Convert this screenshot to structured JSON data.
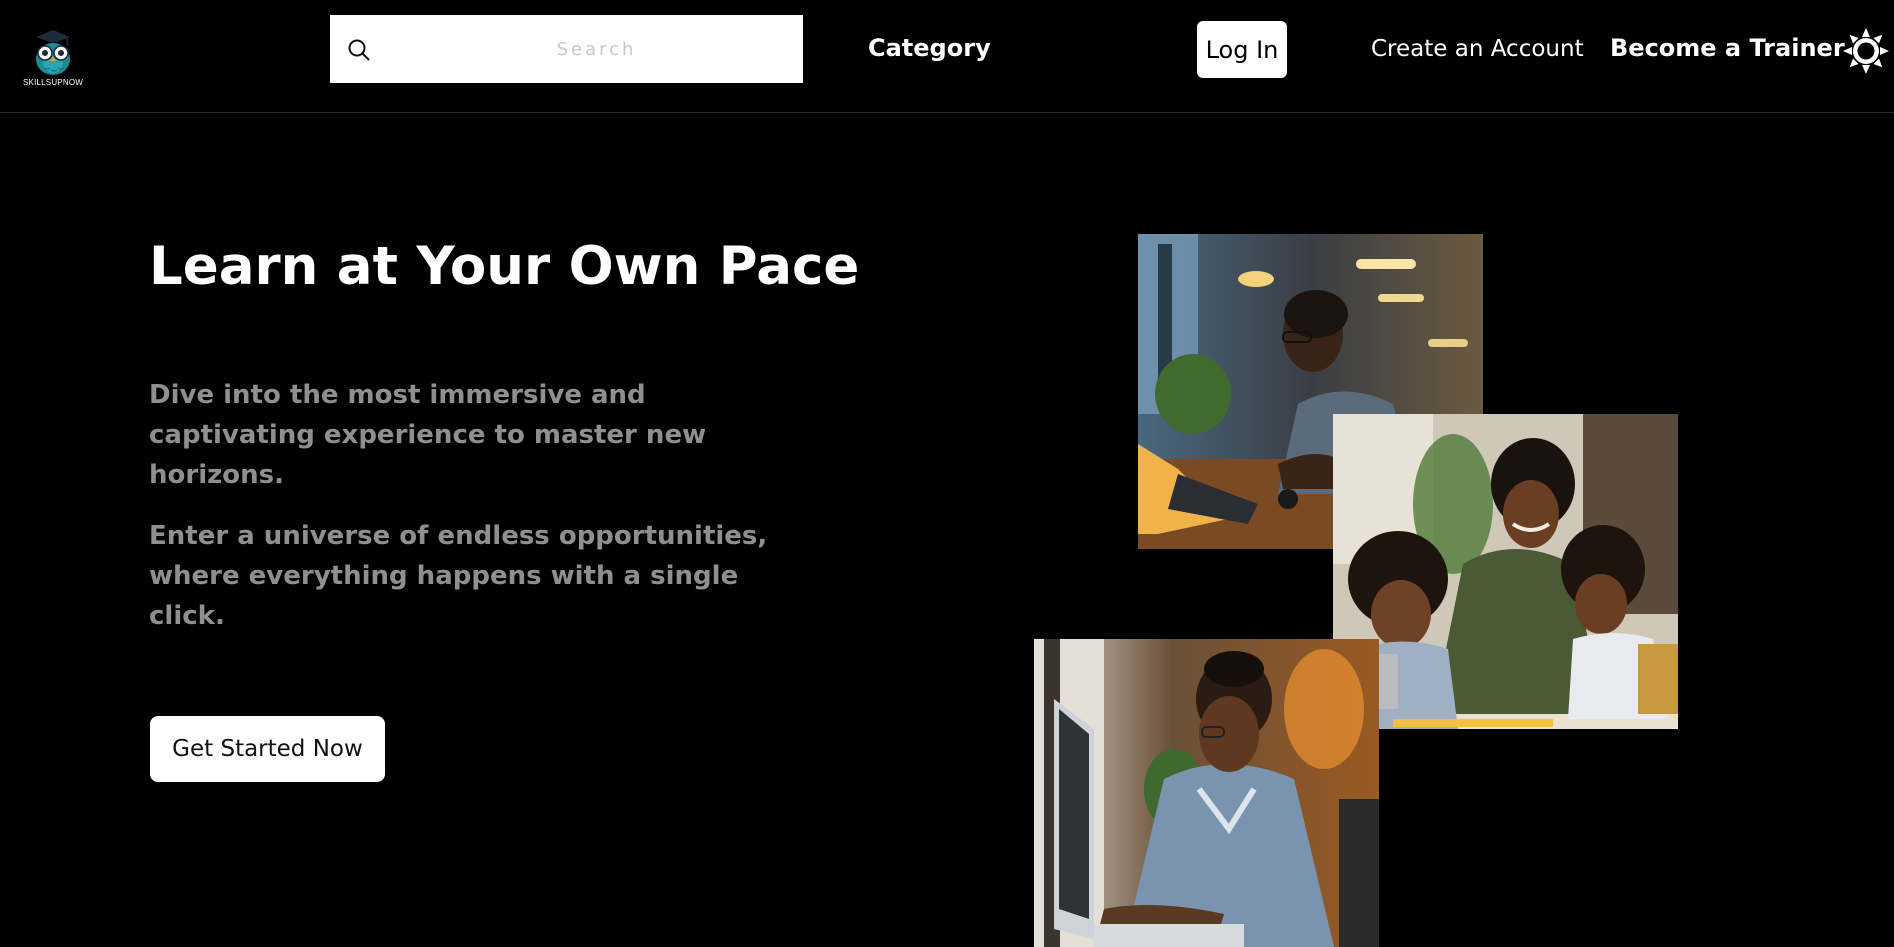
{
  "brand": {
    "name": "SKILLSUPNOW"
  },
  "search": {
    "placeholder": "Search"
  },
  "nav": {
    "category": "Category",
    "login": "Log In",
    "create_account": "Create an Account",
    "become_trainer": "Become a Trainer",
    "theme_icon": "sun-icon"
  },
  "hero": {
    "title": "Learn at Your Own Pace",
    "paragraph1": "Dive into the most immersive and captivating experience to master new horizons.",
    "paragraph2": "Enter a universe of endless opportunities, where everything happens with a single click.",
    "cta": "Get Started Now"
  },
  "colors": {
    "background": "#000000",
    "text": "#ffffff",
    "muted_text": "#8f8f8f",
    "owl_teal": "#1f8a94"
  }
}
